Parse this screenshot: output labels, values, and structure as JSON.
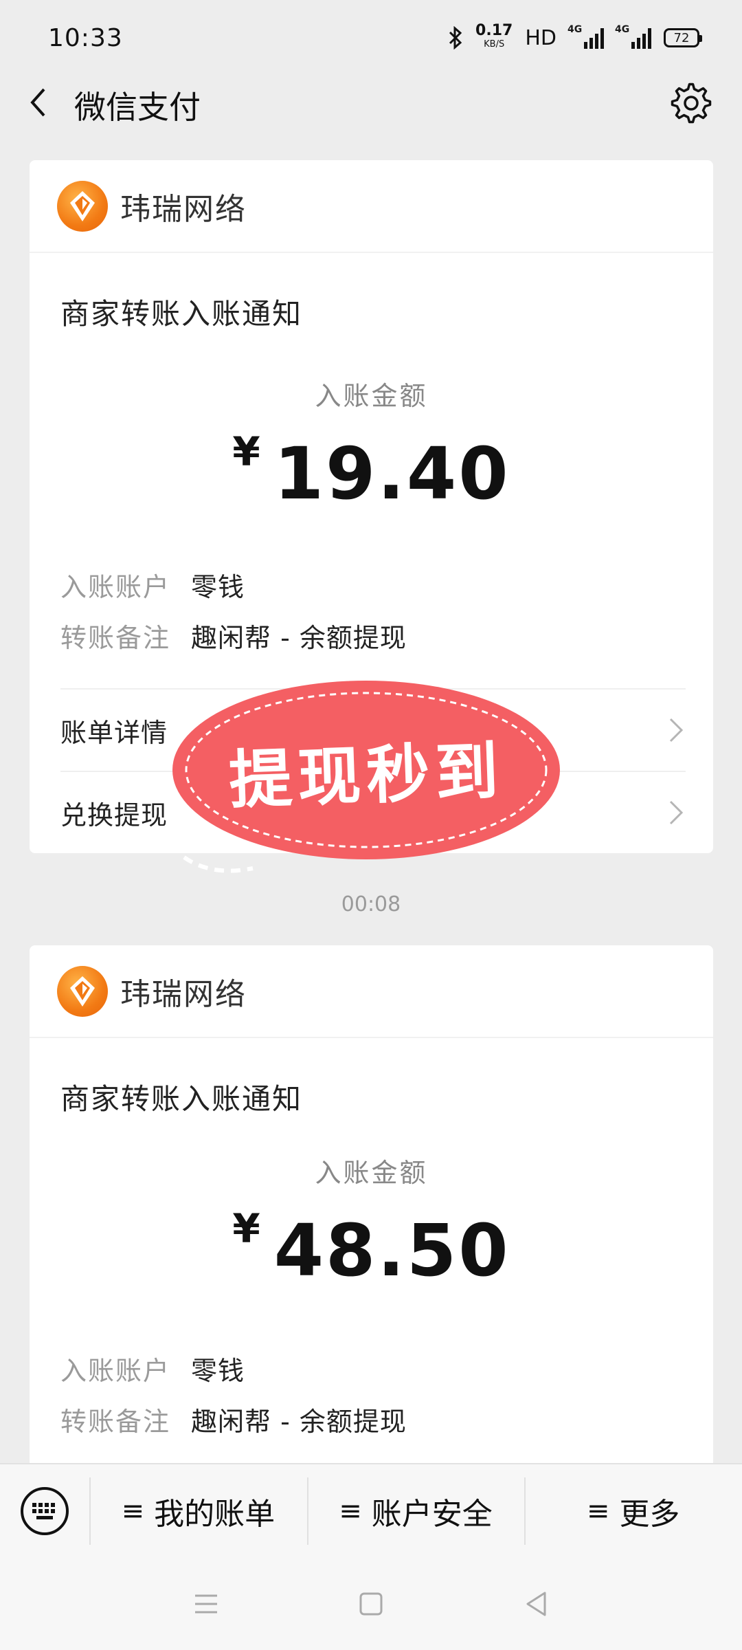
{
  "status_bar": {
    "time": "10:33",
    "speed_value": "0.17",
    "speed_unit": "KB/S",
    "hd": "HD",
    "network_1": "4G",
    "network_2": "4G",
    "battery": "72"
  },
  "nav": {
    "title": "微信支付"
  },
  "cards": [
    {
      "merchant": "玮瑞网络",
      "notice_title": "商家转账入账通知",
      "amount_label": "入账金额",
      "currency": "¥",
      "amount": "19.40",
      "details": [
        {
          "key": "入账账户",
          "value": "零钱"
        },
        {
          "key": "转账备注",
          "value": "趣闲帮 - 余额提现"
        }
      ],
      "links": [
        "账单详情",
        "兑换提现"
      ]
    },
    {
      "merchant": "玮瑞网络",
      "notice_title": "商家转账入账通知",
      "amount_label": "入账金额",
      "currency": "¥",
      "amount": "48.50",
      "details": [
        {
          "key": "入账账户",
          "value": "零钱"
        },
        {
          "key": "转账备注",
          "value": "趣闲帮 - 余额提现"
        }
      ]
    }
  ],
  "sticker": {
    "text": "提现秒到",
    "color": "#f45f63"
  },
  "timestamp": "00:08",
  "bottom_menu": {
    "items": [
      "我的账单",
      "账户安全",
      "更多"
    ]
  },
  "colors": {
    "background": "#ededed",
    "card": "#ffffff",
    "logo_orange": "#f27a14"
  }
}
